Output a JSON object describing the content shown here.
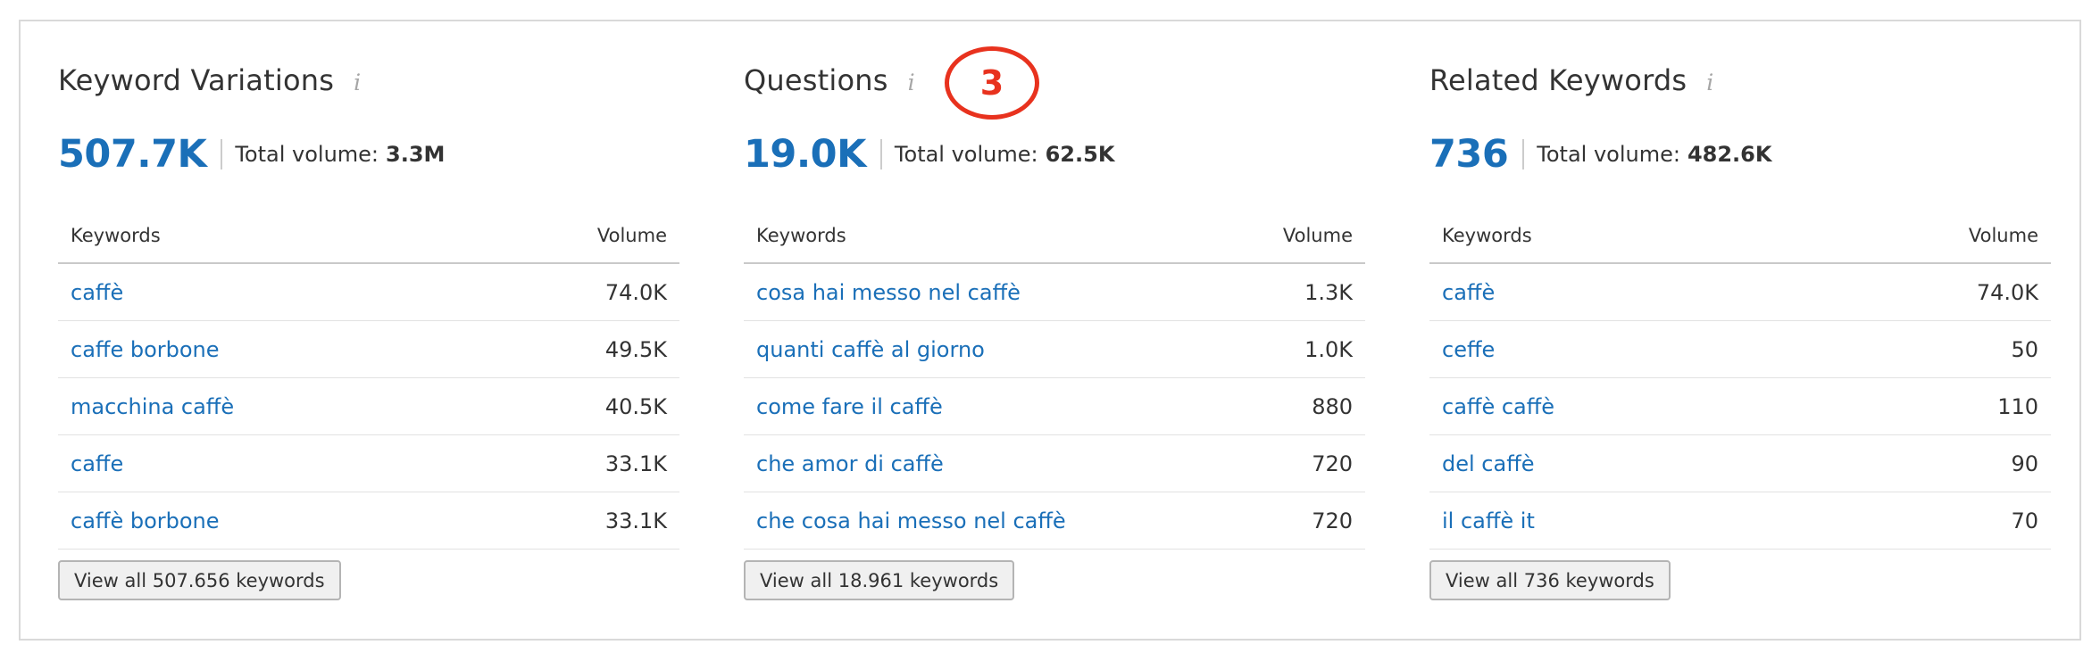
{
  "panels": [
    {
      "title": "Keyword Variations",
      "info_icon": "i",
      "count": "507.7K",
      "volume_label": "Total volume:",
      "volume_value": "3.3M",
      "columns": {
        "keywords": "Keywords",
        "volume": "Volume"
      },
      "rows": [
        {
          "keyword": "caffè",
          "volume": "74.0K"
        },
        {
          "keyword": "caffe borbone",
          "volume": "49.5K"
        },
        {
          "keyword": "macchina caffè",
          "volume": "40.5K"
        },
        {
          "keyword": "caffe",
          "volume": "33.1K"
        },
        {
          "keyword": "caffè borbone",
          "volume": "33.1K"
        }
      ],
      "view_all_label": "View all 507.656 keywords"
    },
    {
      "title": "Questions",
      "info_icon": "i",
      "count": "19.0K",
      "volume_label": "Total volume:",
      "volume_value": "62.5K",
      "columns": {
        "keywords": "Keywords",
        "volume": "Volume"
      },
      "rows": [
        {
          "keyword": "cosa hai messo nel caffè",
          "volume": "1.3K"
        },
        {
          "keyword": "quanti caffè al giorno",
          "volume": "1.0K"
        },
        {
          "keyword": "come fare il caffè",
          "volume": "880"
        },
        {
          "keyword": "che amor di caffè",
          "volume": "720"
        },
        {
          "keyword": "che cosa hai messo nel caffè",
          "volume": "720"
        }
      ],
      "view_all_label": "View all 18.961 keywords"
    },
    {
      "title": "Related Keywords",
      "info_icon": "i",
      "count": "736",
      "volume_label": "Total volume:",
      "volume_value": "482.6K",
      "columns": {
        "keywords": "Keywords",
        "volume": "Volume"
      },
      "rows": [
        {
          "keyword": "caffè",
          "volume": "74.0K"
        },
        {
          "keyword": "ceffe",
          "volume": "50"
        },
        {
          "keyword": "caffè caffè",
          "volume": "110"
        },
        {
          "keyword": "del caffè",
          "volume": "90"
        },
        {
          "keyword": "il caffè it",
          "volume": "70"
        }
      ],
      "view_all_label": "View all 736 keywords"
    }
  ],
  "annotation": {
    "number": "3",
    "color": "#e8321e"
  },
  "colors": {
    "link": "#1a6fb8",
    "text": "#333333",
    "border": "#d9d9d9"
  }
}
